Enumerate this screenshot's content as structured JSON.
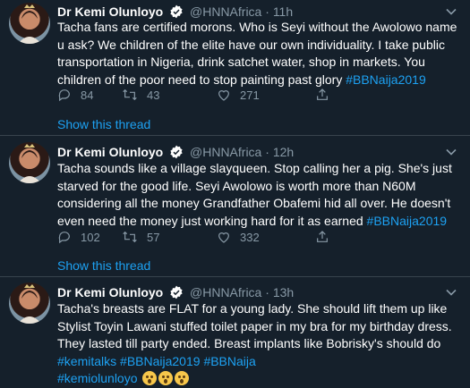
{
  "tweets": [
    {
      "name": "Dr Kemi Olunloyo",
      "handle": "@HNNAfrica",
      "separator": "·",
      "time": "11h",
      "text_parts": [
        "Tacha fans are certified morons. Who is Seyi without the Awolowo name u ask? We children of the elite have our own individuality. I take public transportation in Nigeria, drink satchet water, shop in markets. You children of the poor need to stop painting past glory "
      ],
      "hashtags": [
        "#BBNaija2019"
      ],
      "replies": "84",
      "retweets": "43",
      "likes": "271",
      "show_thread": "Show this thread"
    },
    {
      "name": "Dr Kemi Olunloyo",
      "handle": "@HNNAfrica",
      "separator": "·",
      "time": "12h",
      "text_parts": [
        "Tacha sounds like a village slayqueen. Stop calling her a pig. She's just starved for the good life. Seyi Awolowo is worth more than N60M considering all the money Grandfather Obafemi hid all over. He doesn't even need the money just working hard for it as earned "
      ],
      "hashtags": [
        "#BBNaija2019"
      ],
      "replies": "102",
      "retweets": "57",
      "likes": "332",
      "show_thread": "Show this thread"
    },
    {
      "name": "Dr Kemi Olunloyo",
      "handle": "@HNNAfrica",
      "separator": "·",
      "time": "13h",
      "text_parts": [
        "Tacha's breasts are FLAT for a young lady. She should lift them up like Stylist Toyin Lawani stuffed toilet paper in my bra for my birthday dress. They lasted till party ended. Breast implants like Bobrisky's should do"
      ],
      "hashtags": [
        "#kemitalks",
        "#BBNaija2019",
        "#BBNaija",
        "#kemiolunloyo"
      ],
      "emojis": [
        "astonished-face",
        "astonished-face",
        "astonished-face"
      ]
    }
  ],
  "colors": {
    "background": "#15202b",
    "text": "#ffffff",
    "muted": "#8899a6",
    "link": "#1da1f2",
    "divider": "#38444d"
  }
}
